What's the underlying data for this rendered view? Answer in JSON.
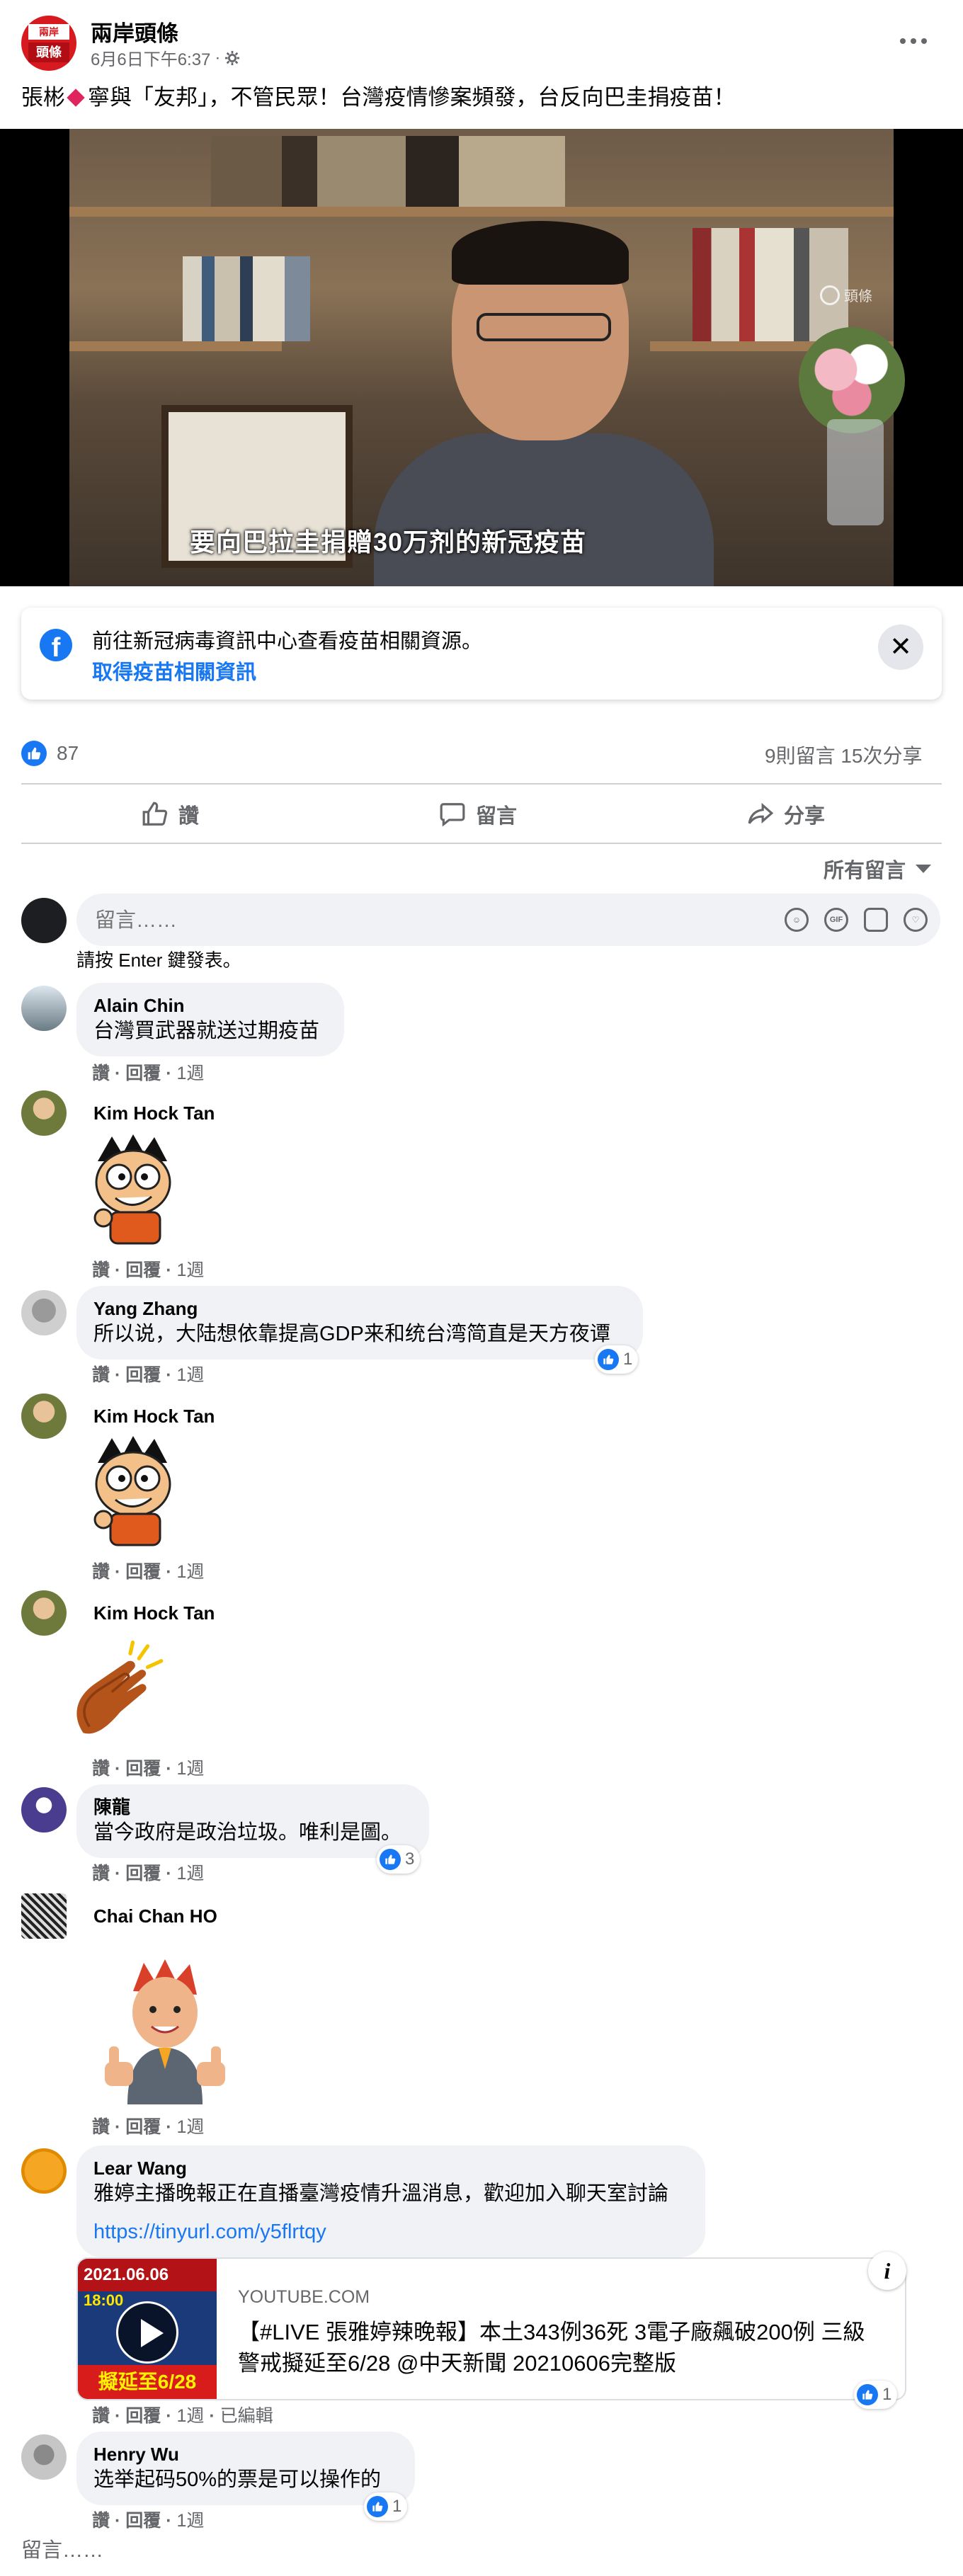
{
  "post": {
    "page_name": "兩岸頭條",
    "logo_text_top": "兩岸",
    "logo_text_bottom": "頭條",
    "timestamp": "6月6日下午6:37",
    "separator": "·",
    "text_before_icon": "張彬",
    "text_after_icon": "寧與「友邦」，不管民眾！台灣疫情慘案頻發，台反向巴圭捐疫苗！",
    "icons": {
      "audience": "gear-icon",
      "more": "more-dots-icon"
    }
  },
  "video": {
    "subtitle": "要向巴拉圭捐贈30万剂的新冠疫苗",
    "watermark": "頭條",
    "controls": [
      "settings-icon",
      "fullscreen-icon",
      "miniplayer-icon",
      "mute-icon"
    ]
  },
  "info_card": {
    "text": "前往新冠病毒資訊中心查看疫苗相關資源。",
    "link": "取得疫苗相關資訊",
    "close": "✕"
  },
  "stats": {
    "likes": "87",
    "comments_shares": "9則留言  15次分享"
  },
  "actions": {
    "like": "讚",
    "comment": "留言",
    "share": "分享"
  },
  "sort": {
    "label": "所有留言"
  },
  "comment_input": {
    "placeholder": "留言……",
    "hint": "請按 Enter 鍵發表。",
    "gif": "GIF"
  },
  "comments": [
    {
      "name": "Alain Chin",
      "text": "台灣買武器就送过期疫苗",
      "like": "讚",
      "reply": "回覆",
      "time": "1週"
    },
    {
      "name": "Kim Hock Tan",
      "text": "",
      "like": "讚",
      "reply": "回覆",
      "time": "1週"
    },
    {
      "name": "Yang Zhang",
      "text": "所以说，大陆想依靠提高GDP来和统台湾简直是天方夜谭",
      "like": "讚",
      "reply": "回覆",
      "time": "1週",
      "reactions": "1"
    },
    {
      "name": "Kim Hock Tan",
      "text": "",
      "like": "讚",
      "reply": "回覆",
      "time": "1週"
    },
    {
      "name": "Kim Hock Tan",
      "text": "",
      "like": "讚",
      "reply": "回覆",
      "time": "1週"
    },
    {
      "name": "陳龍",
      "text": "當今政府是政治垃圾。唯利是圖。",
      "like": "讚",
      "reply": "回覆",
      "time": "1週",
      "reactions": "3"
    },
    {
      "name": "Chai Chan HO",
      "text": "",
      "like": "讚",
      "reply": "回覆",
      "time": "1週"
    },
    {
      "name": "Lear Wang",
      "text": "雅婷主播晚報正在直播臺灣疫情升溫消息，歡迎加入聊天室討論",
      "link": "https://tinyurl.com/y5flrtqy",
      "like": "讚",
      "reply": "回覆",
      "time": "1週",
      "edited": "已編輯",
      "reactions": "1"
    },
    {
      "name": "Henry Wu",
      "text": "选举起码50%的票是可以操作的",
      "like": "讚",
      "reply": "回覆",
      "time": "1週",
      "reactions": "1"
    }
  ],
  "link_preview": {
    "domain": "YOUTUBE.COM",
    "title": "【#LIVE 張雅婷辣晚報】本土343例36死 3電子廠飆破200例 三級警戒擬延至6/28 @中天新聞 20210606完整版",
    "thumb_date": "2021.06.06",
    "thumb_time": "18:00",
    "thumb_caption": "擬延至6/28"
  },
  "bottom_input": {
    "placeholder": "留言……"
  },
  "colors": {
    "accent": "#1877f2",
    "secondary_text": "#65676b",
    "bubble": "#f0f2f5",
    "brand_red": "#d71920"
  }
}
